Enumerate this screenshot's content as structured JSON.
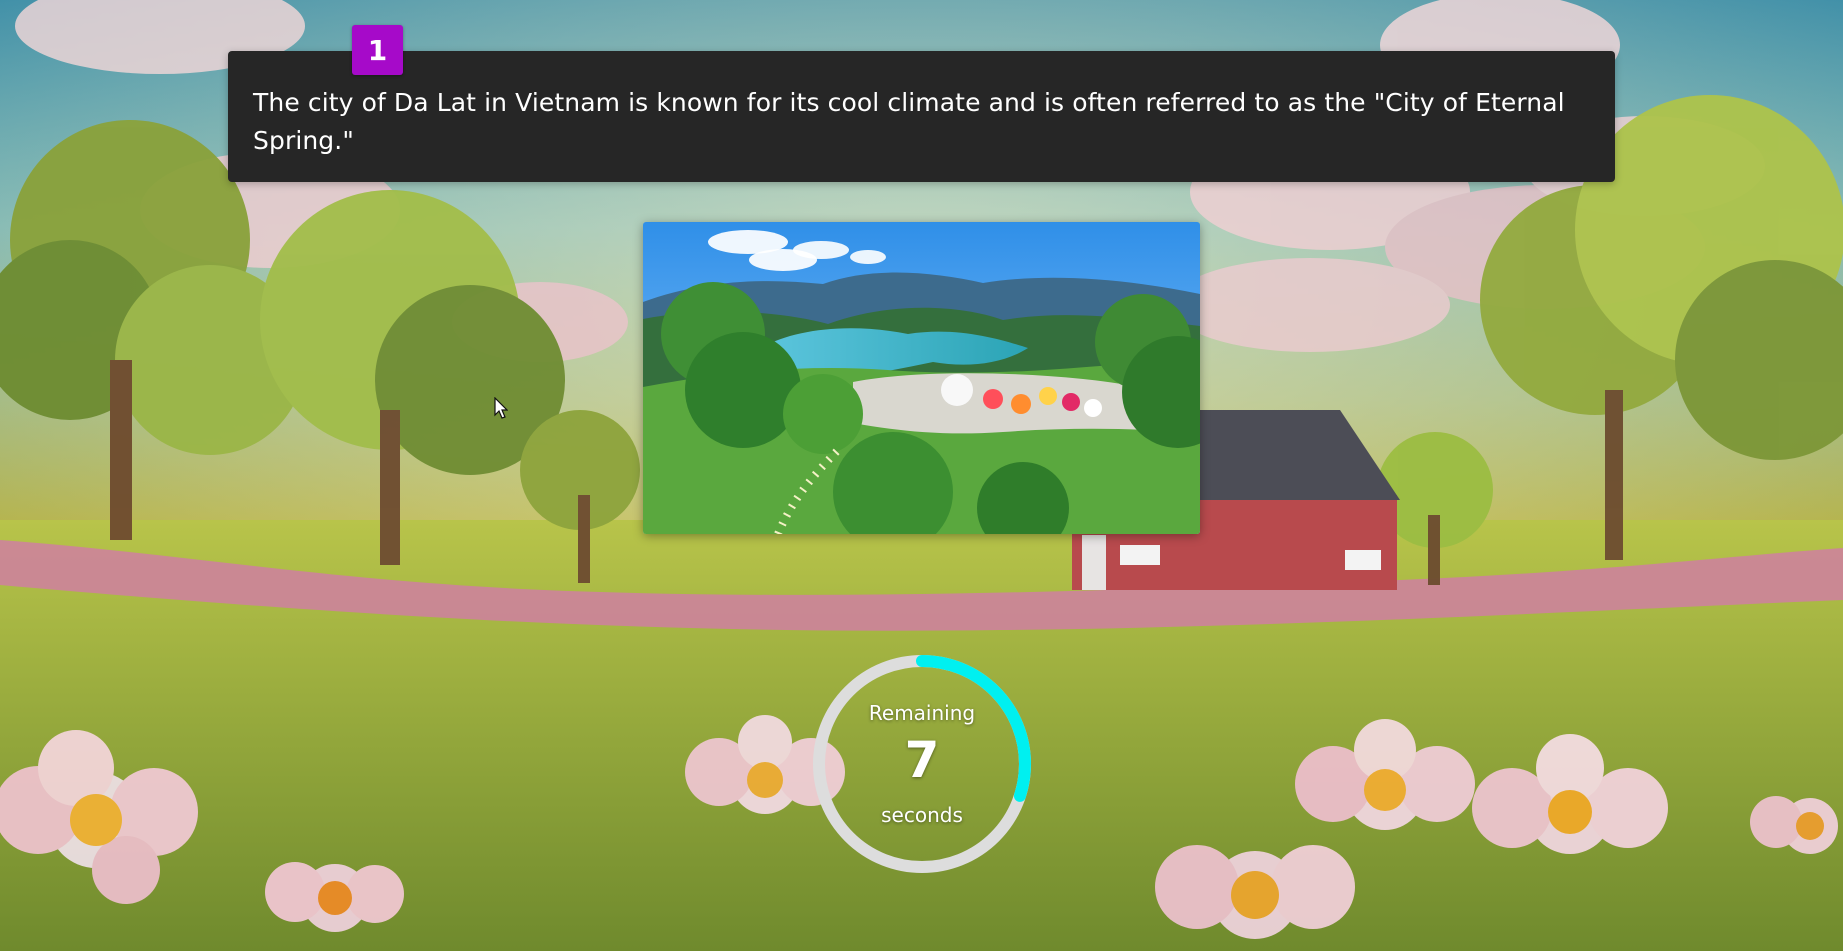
{
  "question": {
    "number": "1",
    "text": "The city of Da Lat in Vietnam is known for its cool climate and is often referred to as the \"City of Eternal Spring.\""
  },
  "timer": {
    "label_top": "Remaining",
    "value": "7",
    "label_bottom": "seconds",
    "progress_fraction": 0.3,
    "ring_color": "#00f0f0",
    "track_color": "#dddddd"
  },
  "colors": {
    "card_background": "#262626",
    "badge_background": "#a60ac9"
  },
  "icons": {
    "pointer": "mouse-pointer-icon"
  }
}
